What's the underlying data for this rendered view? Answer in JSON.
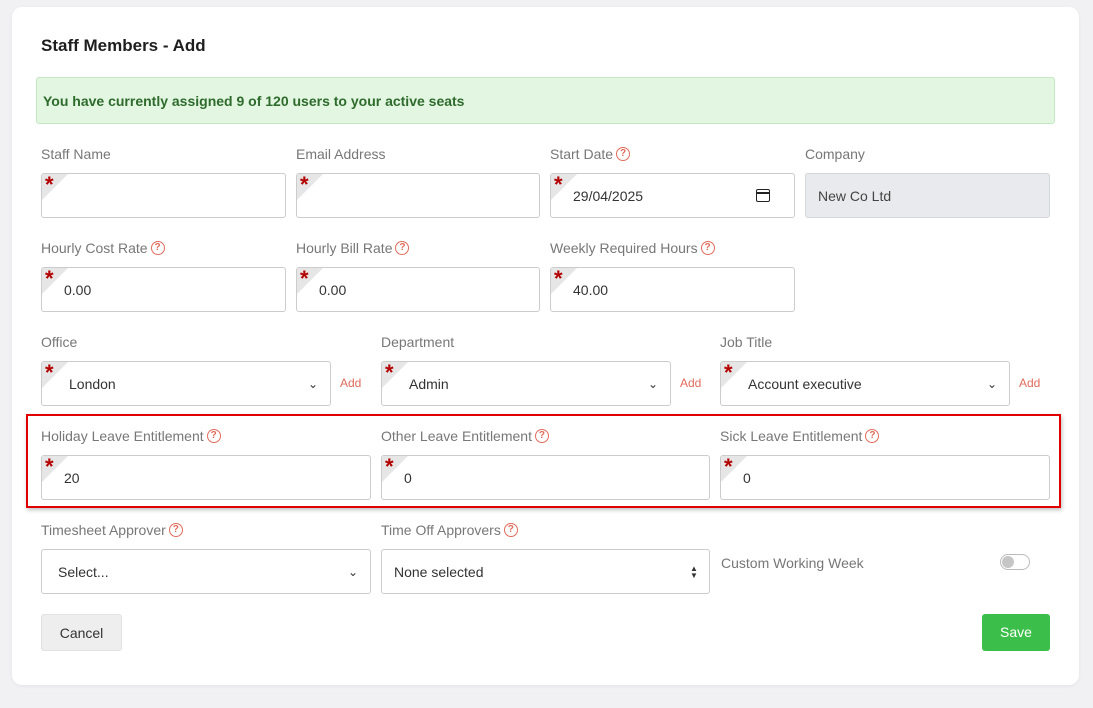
{
  "page": {
    "title": "Staff Members - Add",
    "alert": "You have currently assigned 9 of 120 users to your active seats"
  },
  "fields": {
    "staff_name": {
      "label": "Staff Name",
      "value": ""
    },
    "email": {
      "label": "Email Address",
      "value": ""
    },
    "start_date": {
      "label": "Start Date",
      "value": "29/04/2025"
    },
    "company": {
      "label": "Company",
      "value": "New Co Ltd"
    },
    "hourly_cost": {
      "label": "Hourly Cost Rate",
      "value": "0.00"
    },
    "hourly_bill": {
      "label": "Hourly Bill Rate",
      "value": "0.00"
    },
    "weekly_hours": {
      "label": "Weekly Required Hours",
      "value": "40.00"
    },
    "office": {
      "label": "Office",
      "value": "London",
      "add": "Add"
    },
    "department": {
      "label": "Department",
      "value": "Admin",
      "add": "Add"
    },
    "job_title": {
      "label": "Job Title",
      "value": "Account executive",
      "add": "Add"
    },
    "holiday_leave": {
      "label": "Holiday Leave Entitlement",
      "value": "20"
    },
    "other_leave": {
      "label": "Other Leave Entitlement",
      "value": "0"
    },
    "sick_leave": {
      "label": "Sick Leave Entitlement",
      "value": "0"
    },
    "timesheet_approver": {
      "label": "Timesheet Approver",
      "value": "Select..."
    },
    "time_off_approvers": {
      "label": "Time Off Approvers",
      "value": "None selected"
    },
    "custom_week": {
      "label": "Custom Working Week",
      "enabled": false
    }
  },
  "buttons": {
    "cancel": "Cancel",
    "save": "Save"
  },
  "icons": {
    "help": "?",
    "required": "*",
    "chevron": "⌄"
  },
  "colors": {
    "accent": "#e06b5b",
    "save": "#3cbf4a",
    "highlight": "#e00000",
    "alert_bg": "#e2f6e1"
  }
}
